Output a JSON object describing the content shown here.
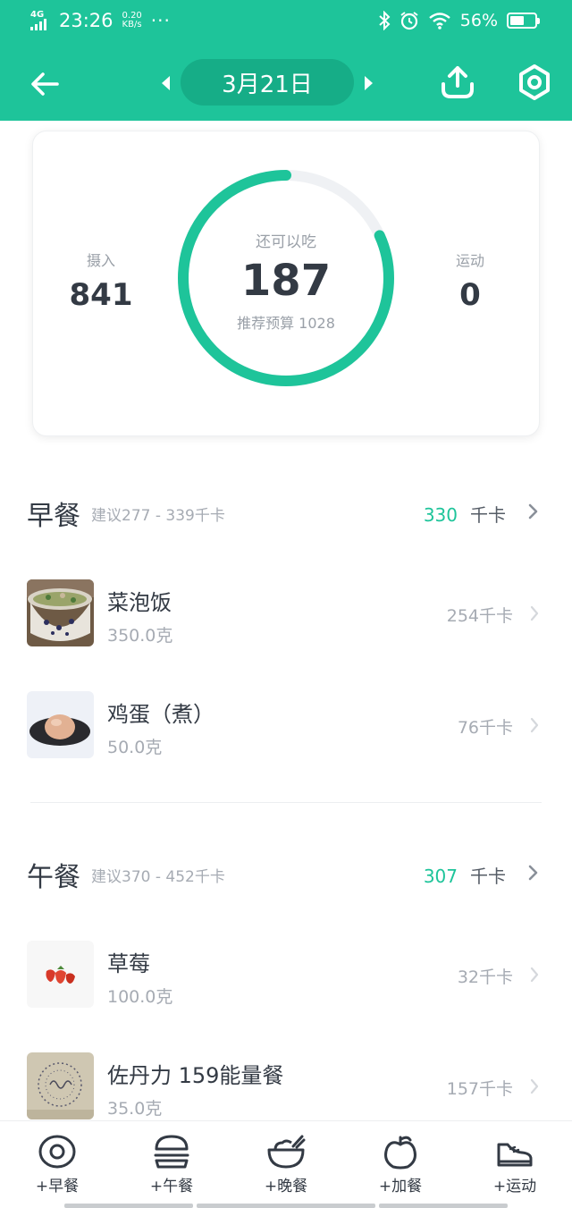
{
  "status_bar": {
    "network": "4G",
    "time": "23:26",
    "speed_value": "0.20",
    "speed_unit": "KB/s",
    "more": "···",
    "battery": "56%",
    "battery_level": 0.56
  },
  "header": {
    "date": "3月21日",
    "icons": [
      "back-arrow-icon",
      "prev-day-icon",
      "next-day-icon",
      "share-upload-icon",
      "settings-icon"
    ]
  },
  "summary": {
    "intake_label": "摄入",
    "intake_value": "841",
    "remaining_label": "还可以吃",
    "remaining_value": "187",
    "budget_label": "推荐预算 1028",
    "exercise_label": "运动",
    "exercise_value": "0",
    "ring_progress": 0.818,
    "accent": "#1ec49a"
  },
  "meals": [
    {
      "title": "早餐",
      "suggestion": "建议277 - 339千卡",
      "calories": "330",
      "unit": "千卡",
      "items": [
        {
          "name": "菜泡饭",
          "qty": "350.0克",
          "cal": "254千卡"
        },
        {
          "name": "鸡蛋（煮）",
          "qty": "50.0克",
          "cal": "76千卡"
        }
      ]
    },
    {
      "title": "午餐",
      "suggestion": "建议370 - 452千卡",
      "calories": "307",
      "unit": "千卡",
      "items": [
        {
          "name": "草莓",
          "qty": "100.0克",
          "cal": "32千卡"
        },
        {
          "name": "佐丹力 159能量餐",
          "qty": "35.0克",
          "cal": "157千卡"
        }
      ]
    }
  ],
  "bottom_nav": [
    {
      "label": "+早餐",
      "icon": "egg-icon"
    },
    {
      "label": "+午餐",
      "icon": "burger-icon"
    },
    {
      "label": "+晚餐",
      "icon": "bowl-icon"
    },
    {
      "label": "+加餐",
      "icon": "apple-icon"
    },
    {
      "label": "+运动",
      "icon": "sneaker-icon"
    }
  ]
}
